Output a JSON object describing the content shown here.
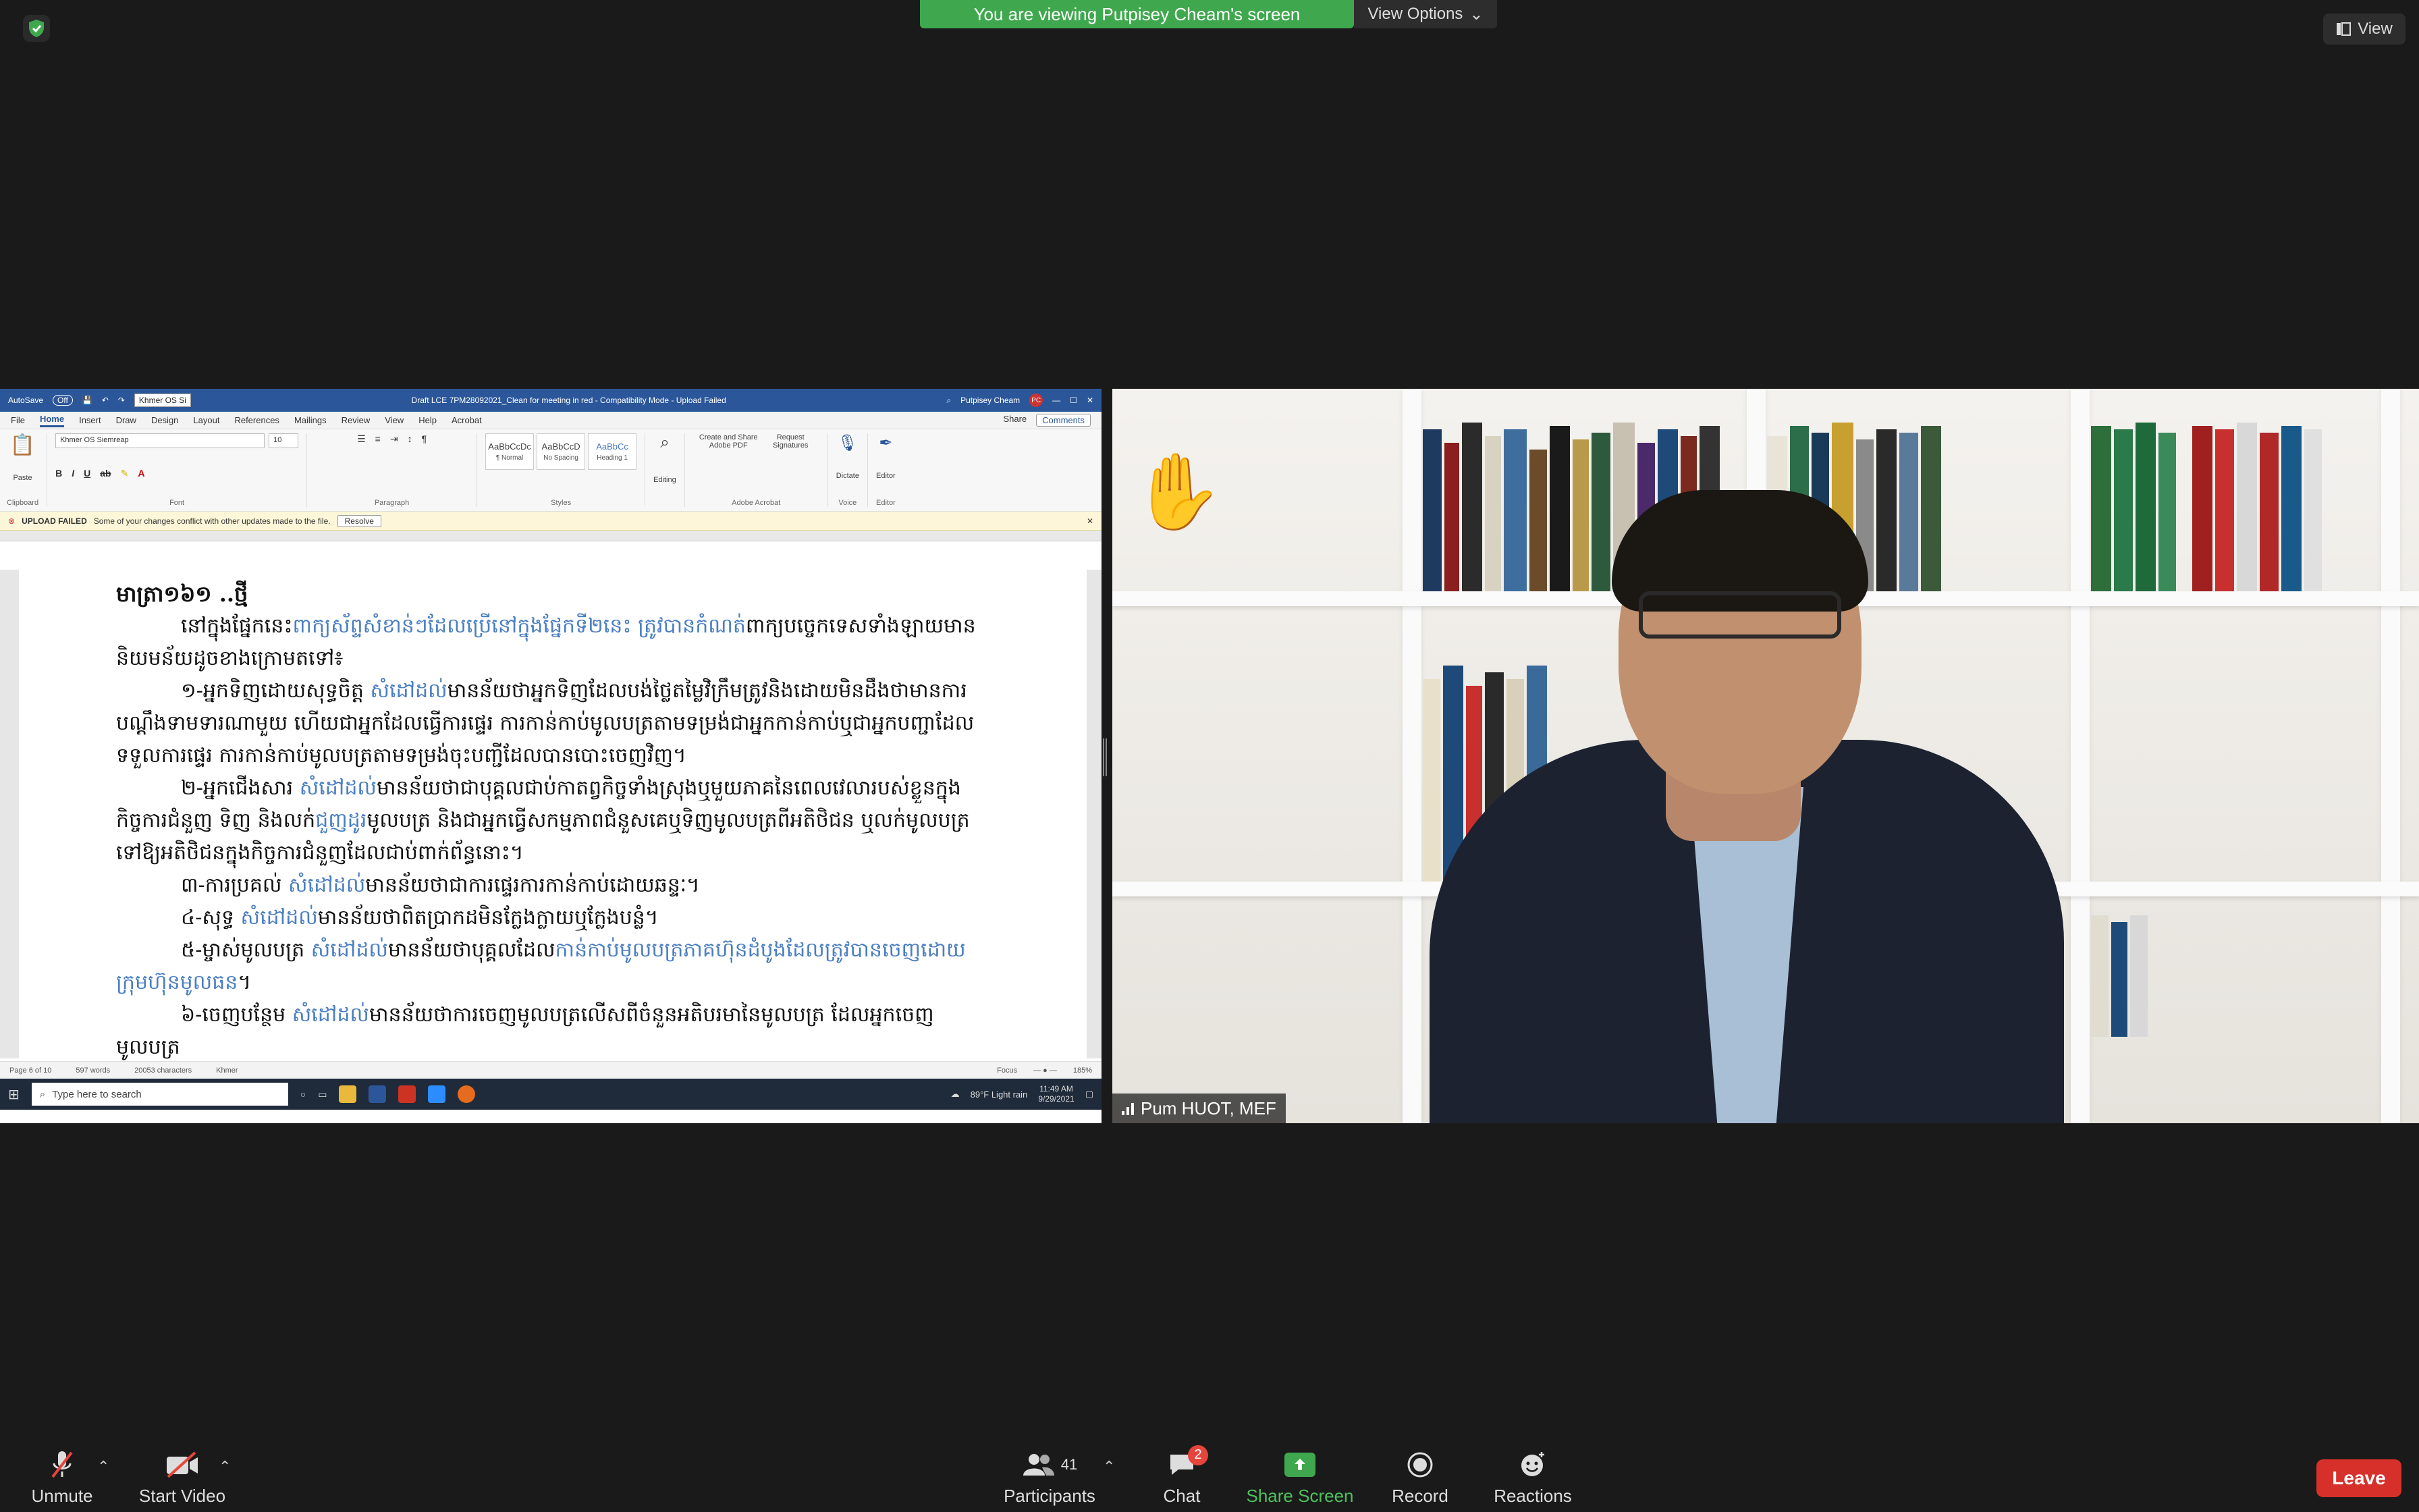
{
  "top_bar": {
    "share_banner": "You are viewing Putpisey Cheam's screen",
    "view_options": "View Options",
    "view_button": "View"
  },
  "word": {
    "titlebar": {
      "autosave": "AutoSave",
      "autosave_state": "Off",
      "font_box": "Khmer OS Si",
      "doc_title": "Draft LCE 7PM28092021_Clean for meeting in red  -  Compatibility Mode  -  Upload Failed",
      "user": "Putpisey Cheam",
      "user_initials": "PC"
    },
    "menu": [
      "File",
      "Home",
      "Insert",
      "Draw",
      "Design",
      "Layout",
      "References",
      "Mailings",
      "Review",
      "View",
      "Help",
      "Acrobat"
    ],
    "menu_active": "Home",
    "share": "Share",
    "comments": "Comments",
    "ribbon": {
      "paste": "Paste",
      "clipboard": "Clipboard",
      "font_name": "Khmer OS Siemreap",
      "font_size": "10",
      "font_group": "Font",
      "paragraph_group": "Paragraph",
      "styles": [
        {
          "preview": "AaBbCcDc",
          "name": "¶ Normal"
        },
        {
          "preview": "AaBbCcD",
          "name": "No Spacing"
        },
        {
          "preview": "AaBbCc",
          "name": "Heading 1"
        }
      ],
      "styles_group": "Styles",
      "editing": "Editing",
      "create_pdf": "Create and Share Adobe PDF",
      "request_sig": "Request Signatures",
      "acrobat_group": "Adobe Acrobat",
      "dictate": "Dictate",
      "voice_group": "Voice",
      "editor": "Editor",
      "editor_group": "Editor"
    },
    "alert": {
      "title": "UPLOAD FAILED",
      "message": "Some of your changes conflict with other updates made to the file.",
      "resolve": "Resolve"
    },
    "document": {
      "heading": "មាត្រា១៦១ ..ថ្មី",
      "p1a": "នៅក្នុងផ្នែកនេះ",
      "p1b": "ពាក្យស័ព្ទសំខាន់ៗដែលប្រើនៅក្នុងផ្នែកទី២នេះ",
      "p1c": "ត្រូវបានកំណត់",
      "p1d": "ពាក្យបច្ចេកទេសទាំងឡាយមាននិយមន័យដូចខាងក្រោមតទៅ៖",
      "p2a": "១-អ្នកទិញដោយសុទ្ធចិត្ត",
      "p2b": "សំដៅដល់",
      "p2c": "មានន័យថាអ្នកទិញដែលបង់ថ្លៃតម្លៃវិក្រឹមត្រូវនិងដោយមិនដឹងថាមានការបណ្តឹងទាមទារណាមួយ ហើយជាអ្នកដែលធ្វើការផ្ទេរ ការកាន់កាប់មូលបត្រតាមទម្រង់ជាអ្នកកាន់កាប់ឬជាអ្នកបញ្ជាដែលទទួលការផ្ទេរ ការកាន់កាប់មូលបត្រតាមទម្រង់ចុះបញ្ជីដែលបានបោះចេញវិញ។",
      "p3a": "២-អ្នកជើងសារ",
      "p3b": "សំដៅដល់",
      "p3c": "មានន័យថាជាបុគ្គលជាប់កាតព្វកិច្ចទាំងស្រុងឬមួយភាគនៃពេលវេលារបស់ខ្លួនក្នុងកិច្ចការជំនួញ ទិញ និងលក់",
      "p3d": "ជួញដូរ",
      "p3e": "មូលបត្រ និងជាអ្នកធ្វើសកម្មភាពជំនួសគេឬទិញមូលបត្រពីអតិថិជន ឬលក់មូលបត្រទៅឱ្យអតិថិជនក្នុងកិច្ចការជំនួញដែលជាប់ពាក់ព័ន្ធនោះ។",
      "p4a": "៣-ការប្រគល់",
      "p4b": "សំដៅដល់",
      "p4c": "មានន័យថាជាការផ្ទេរការកាន់កាប់ដោយឆន្ទៈ។",
      "p5a": "៤-សុទ្ធ",
      "p5b": "សំដៅដល់",
      "p5c": "មានន័យថាពិតប្រាកដមិនក្លែងក្លាយឬក្លែងបន្លំ។",
      "p6a": "៥-ម្ចាស់មូលបត្រ",
      "p6b": "សំដៅដល់",
      "p6c": "មានន័យថាបុគ្គលដែល",
      "p6d": "កាន់កាប់មូលបត្រភាគហ៊ុនដំបូងដែលត្រូវបានចេញដោយក្រុមហ៊ុនមូលធន",
      "p6e": "។",
      "p7a": "៦-ចេញបន្ថែម",
      "p7b": "សំដៅដល់",
      "p7c": "មានន័យថាការចេញមូលបត្រលើសពីចំនួនអតិបរមានៃមូលបត្រ ដែលអ្នកចេញមូលបត្រ"
    },
    "status": {
      "page": "Page 6 of 10",
      "words": "597 words",
      "chars": "20053 characters",
      "lang": "Khmer",
      "focus": "Focus",
      "zoom": "185%"
    },
    "taskbar": {
      "search": "Type here to search",
      "weather": "89°F  Light rain",
      "time": "11:49 AM",
      "date": "9/29/2021"
    }
  },
  "video": {
    "participant_name": "Pum HUOT, MEF",
    "reaction": "✋"
  },
  "toolbar": {
    "unmute": "Unmute",
    "start_video": "Start Video",
    "participants": "Participants",
    "participants_count": "41",
    "chat": "Chat",
    "chat_badge": "2",
    "share_screen": "Share Screen",
    "record": "Record",
    "reactions": "Reactions",
    "leave": "Leave"
  },
  "colors": {
    "share_green": "#3fa84e",
    "leave_red": "#d7302a",
    "word_blue": "#2b579a",
    "khmer_link_blue": "#4a7ec2"
  }
}
